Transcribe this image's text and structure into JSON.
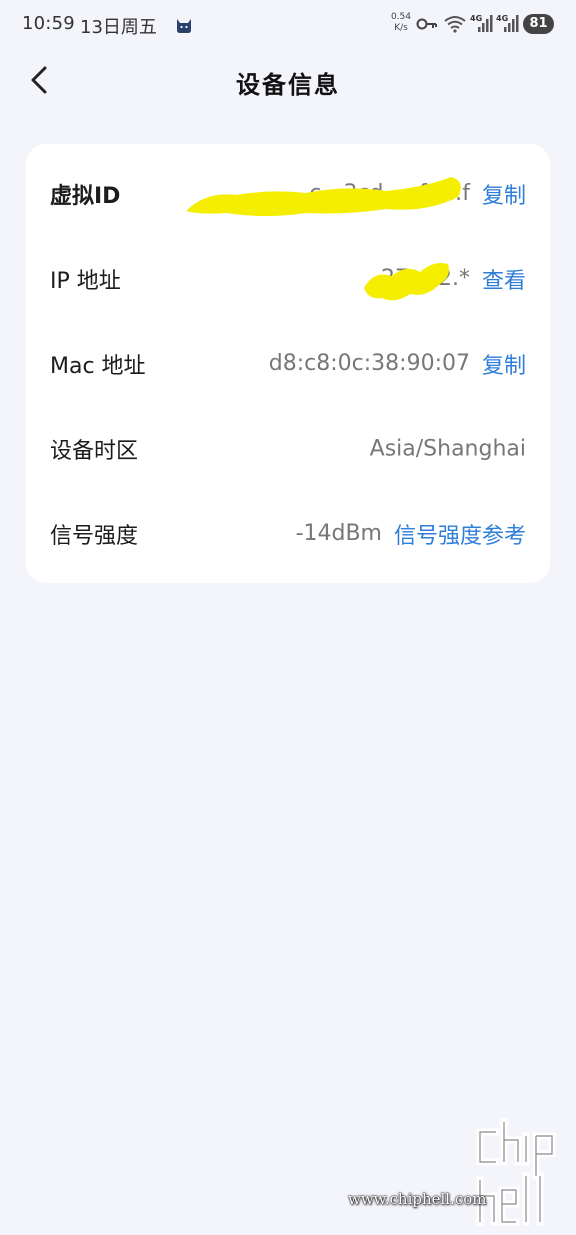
{
  "status_bar": {
    "time": "10:59",
    "date": "13日周五",
    "net_speed_value": "0.54",
    "net_speed_unit": "K/s",
    "signal1_tag": "4G",
    "signal2_tag": "4G",
    "battery": "81"
  },
  "header": {
    "title": "设备信息"
  },
  "rows": [
    {
      "label": "虚拟ID",
      "value": "c…3cd…efa…f",
      "action": "复制"
    },
    {
      "label": "IP 地址",
      "value": "27.…2.*",
      "action": "查看"
    },
    {
      "label": "Mac 地址",
      "value": "d8:c8:0c:38:90:07",
      "action": "复制"
    },
    {
      "label": "设备时区",
      "value": "Asia/Shanghai"
    },
    {
      "label": "信号强度",
      "value": "-14dBm",
      "action": "信号强度参考"
    }
  ],
  "watermark": {
    "url": "www.chiphell.com",
    "logo": "chip hell"
  },
  "colors": {
    "background": "#f4f5fa",
    "card": "#ffffff",
    "link": "#2f7ed8",
    "redaction": "#f5ee00"
  }
}
